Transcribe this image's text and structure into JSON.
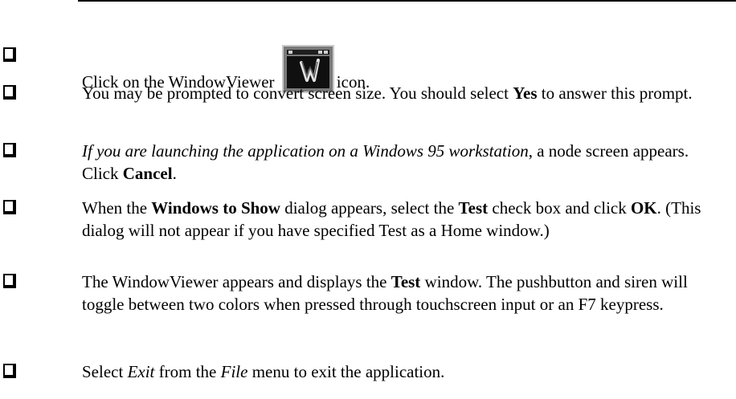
{
  "steps": [
    {
      "segments": [
        {
          "text": "Click on the WindowViewer ",
          "style": "normal"
        },
        {
          "icon": "windowviewer-icon"
        },
        {
          "text": "icon.",
          "style": "normal"
        }
      ]
    },
    {
      "segments": [
        {
          "text": "You may be prompted to convert screen size. You should select ",
          "style": "normal"
        },
        {
          "text": "Yes",
          "style": "bold"
        },
        {
          "text": " to answer this prompt.",
          "style": "normal"
        }
      ]
    },
    {
      "segments": [
        {
          "text": "If you are launching the application on a Windows 95 workstation",
          "style": "italic"
        },
        {
          "text": ", a node screen appears. Click ",
          "style": "normal"
        },
        {
          "text": "Cancel",
          "style": "bold"
        },
        {
          "text": ".",
          "style": "normal"
        }
      ]
    },
    {
      "segments": [
        {
          "text": "When the ",
          "style": "normal"
        },
        {
          "text": "Windows to Show",
          "style": "bold"
        },
        {
          "text": " dialog appears, select the ",
          "style": "normal"
        },
        {
          "text": "Test",
          "style": "bold"
        },
        {
          "text": " check box and click ",
          "style": "normal"
        },
        {
          "text": "OK",
          "style": "bold"
        },
        {
          "text": ". (This dialog will not appear if you have specified Test as a Home window.)",
          "style": "normal"
        }
      ]
    },
    {
      "segments": [
        {
          "text": "The WindowViewer appears and displays the ",
          "style": "normal"
        },
        {
          "text": "Test",
          "style": "bold"
        },
        {
          "text": " window. The pushbutton and siren will toggle between two colors when pressed through touchscreen input or an F7 keypress.",
          "style": "normal"
        }
      ]
    },
    {
      "segments": [
        {
          "text": "Select ",
          "style": "normal"
        },
        {
          "text": "Exit",
          "style": "italic"
        },
        {
          "text": " from the ",
          "style": "normal"
        },
        {
          "text": "File",
          "style": "italic"
        },
        {
          "text": " menu to exit the application.",
          "style": "normal"
        }
      ]
    }
  ]
}
